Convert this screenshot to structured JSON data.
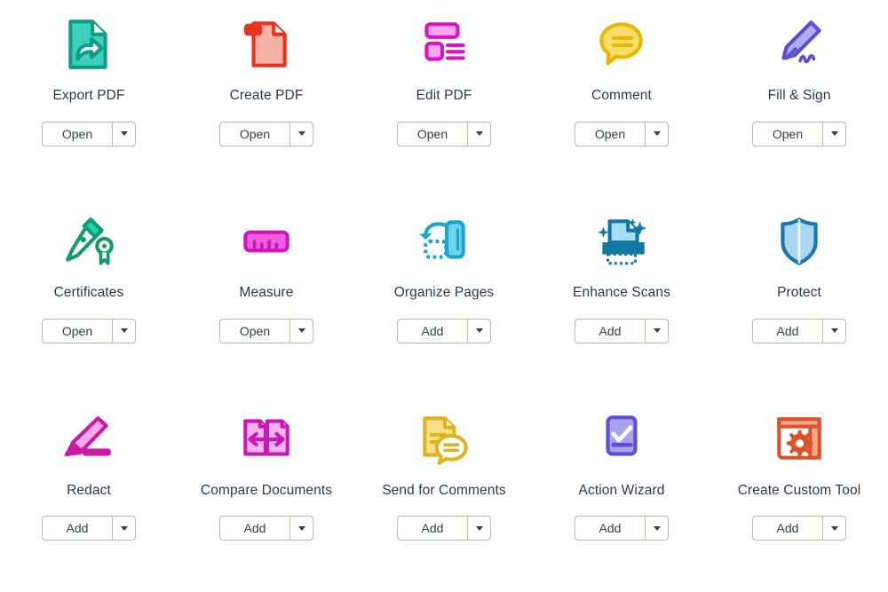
{
  "panel": {
    "name": "acrobat-tools-panel",
    "background": "#ffffff",
    "label_color": "#2b3a4a",
    "button_border_color": "#b9bca4"
  },
  "tools": [
    {
      "id": "export-pdf",
      "label": "Export PDF",
      "icon": "export-pdf-icon",
      "action_label": "Open",
      "color_stroke": "#0f9b86",
      "color_fill": "#3fd0bb",
      "color_accent": "#0f9b86"
    },
    {
      "id": "create-pdf",
      "label": "Create PDF",
      "icon": "create-pdf-icon",
      "action_label": "Open",
      "color_stroke": "#e8331c",
      "color_fill": "#f7b2a8",
      "color_accent": "#e8331c"
    },
    {
      "id": "edit-pdf",
      "label": "Edit PDF",
      "icon": "edit-pdf-icon",
      "action_label": "Open",
      "color_stroke": "#d911c9",
      "color_fill": "#f7a8ef",
      "color_accent": "#d911c9"
    },
    {
      "id": "comment",
      "label": "Comment",
      "icon": "comment-icon",
      "action_label": "Open",
      "color_stroke": "#e6b800",
      "color_fill": "#f7dd6b",
      "color_accent": "#e6b800"
    },
    {
      "id": "fill-and-sign",
      "label": "Fill & Sign",
      "icon": "fill-sign-icon",
      "action_label": "Open",
      "color_stroke": "#5b4fd6",
      "color_fill": "#b3adf0",
      "color_accent": "#5b4fd6"
    },
    {
      "id": "certificates",
      "label": "Certificates",
      "icon": "certificates-icon",
      "action_label": "Open",
      "color_stroke": "#0f9b6c",
      "color_fill": "#16d9b0",
      "color_accent": "#0f9b6c"
    },
    {
      "id": "measure",
      "label": "Measure",
      "icon": "measure-icon",
      "action_label": "Open",
      "color_stroke": "#cc17b8",
      "color_fill": "#f25de0",
      "color_accent": "#cc17b8"
    },
    {
      "id": "organize-pages",
      "label": "Organize Pages",
      "icon": "organize-pages-icon",
      "action_label": "Add",
      "color_stroke": "#17a7c9",
      "color_fill": "#6fd4e8",
      "color_accent": "#17a7c9"
    },
    {
      "id": "enhance-scans",
      "label": "Enhance Scans",
      "icon": "enhance-scans-icon",
      "action_label": "Add",
      "color_stroke": "#1178a3",
      "color_fill": "#a8dcf2",
      "color_accent": "#1178a3"
    },
    {
      "id": "protect",
      "label": "Protect",
      "icon": "protect-icon",
      "action_label": "Add",
      "color_stroke": "#1878ad",
      "color_fill": "#a9d7f0",
      "color_accent": "#1878ad"
    },
    {
      "id": "redact",
      "label": "Redact",
      "icon": "redact-icon",
      "action_label": "Add",
      "color_stroke": "#cc17a8",
      "color_fill": "#f5a9e6",
      "color_accent": "#cc17a8"
    },
    {
      "id": "compare-documents",
      "label": "Compare Documents",
      "icon": "compare-documents-icon",
      "action_label": "Add",
      "color_stroke": "#cc17b8",
      "color_fill": "#f2b4ee",
      "color_accent": "#cc17b8"
    },
    {
      "id": "send-for-comments",
      "label": "Send for Comments",
      "icon": "send-for-comments-icon",
      "action_label": "Add",
      "color_stroke": "#e0b41e",
      "color_fill": "#f9e08a",
      "color_accent": "#e0b41e"
    },
    {
      "id": "action-wizard",
      "label": "Action Wizard",
      "icon": "action-wizard-icon",
      "action_label": "Add",
      "color_stroke": "#5b4fd6",
      "color_fill": "#a9a3ef",
      "color_accent": "#5b4fd6"
    },
    {
      "id": "create-custom-tool",
      "label": "Create Custom Tool",
      "icon": "create-custom-tool-icon",
      "action_label": "Add",
      "color_stroke": "#d9542b",
      "color_fill": "#f2a88c",
      "color_accent": "#d9542b"
    }
  ]
}
